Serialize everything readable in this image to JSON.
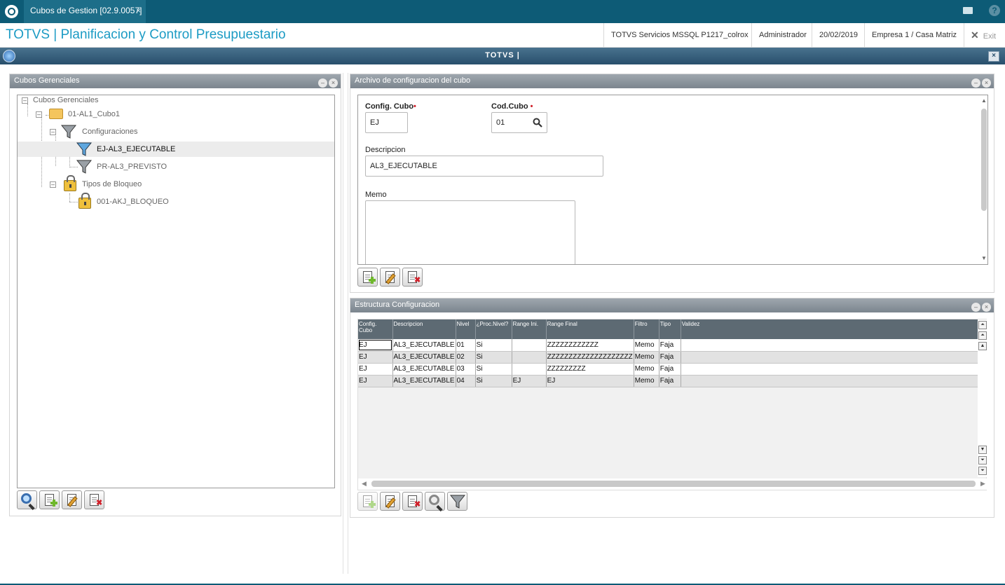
{
  "topbar": {
    "tab_label": "Cubos de Gestion [02.9.0057]",
    "tab_close": "×"
  },
  "header": {
    "title": "TOTVS | Planificacion y Control Presupuestario",
    "environment": "TOTVS Servicios MSSQL P1217_colrox",
    "user": "Administrador",
    "date": "20/02/2019",
    "company": "Empresa 1 / Casa Matriz",
    "exit_label": "Exit"
  },
  "window": {
    "title": "TOTVS |",
    "close": "×"
  },
  "left_panel": {
    "title": "Cubos Gerenciales",
    "tree": {
      "root": "Cubos Gerenciales",
      "cube": "01-AL1_Cubo1",
      "configs_label": "Configuraciones",
      "config_items": [
        "EJ-AL3_EJECUTABLE",
        "PR-AL3_PREVISTO"
      ],
      "locks_label": "Tipos de Bloqueo",
      "lock_items": [
        "001-AKJ_BLOQUEO"
      ]
    }
  },
  "config_panel": {
    "title": "Archivo de configuracion del cubo",
    "config_cubo_label": "Config. Cubo",
    "config_cubo_value": "EJ",
    "cod_cubo_label": "Cod.Cubo",
    "cod_cubo_value": "01",
    "required_mark": "•",
    "descripcion_label": "Descripcion",
    "descripcion_value": "AL3_EJECUTABLE",
    "memo_label": "Memo",
    "memo_value": ""
  },
  "structure_panel": {
    "title": "Estructura Configuracion",
    "columns": [
      "Config. Cubo",
      "Descripcion",
      "Nivel",
      "¿Proc.Nivel?",
      "Range Ini.",
      "Range Final",
      "Filtro",
      "Tipo",
      "Validez"
    ],
    "rows": [
      [
        "EJ",
        "AL3_EJECUTABLE",
        "01",
        "Si",
        "",
        "ZZZZZZZZZZZZ",
        "Memo",
        "Faja",
        ""
      ],
      [
        "EJ",
        "AL3_EJECUTABLE",
        "02",
        "Si",
        "",
        "ZZZZZZZZZZZZZZZZZZZZ",
        "Memo",
        "Faja",
        ""
      ],
      [
        "EJ",
        "AL3_EJECUTABLE",
        "03",
        "Si",
        "",
        "ZZZZZZZZZ",
        "Memo",
        "Faja",
        ""
      ],
      [
        "EJ",
        "AL3_EJECUTABLE",
        "04",
        "Si",
        "EJ",
        "EJ",
        "Memo",
        "Faja",
        ""
      ]
    ]
  },
  "colors": {
    "accent": "#0d5b76",
    "title_blue": "#1c9bc4",
    "panel_header": "#8a939b"
  }
}
